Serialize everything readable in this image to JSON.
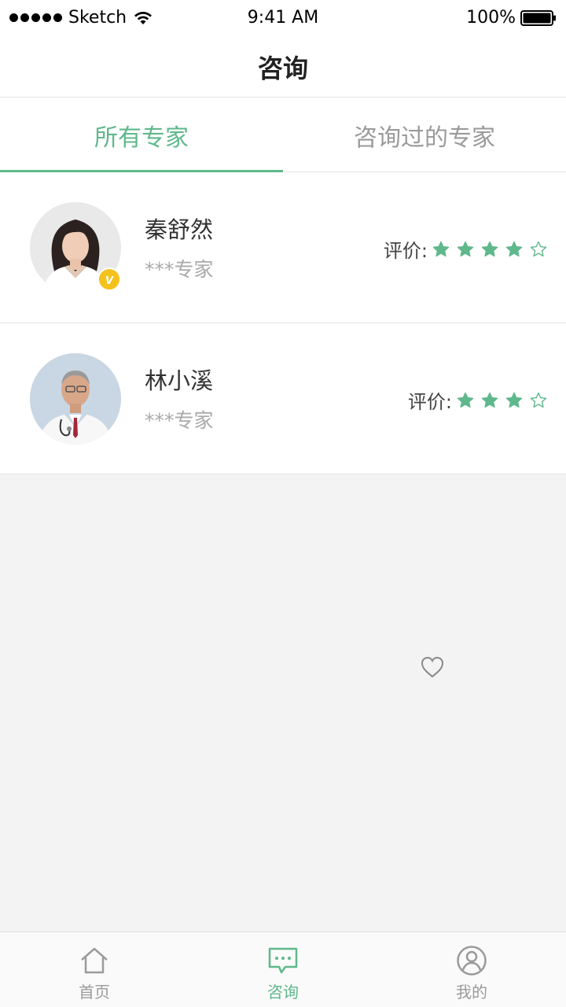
{
  "status_bar": {
    "carrier": "Sketch",
    "time": "9:41 AM",
    "battery": "100%"
  },
  "header": {
    "title": "咨询"
  },
  "tabs": [
    {
      "label": "所有专家",
      "active": true
    },
    {
      "label": "咨询过的专家",
      "active": false
    }
  ],
  "experts": [
    {
      "name": "秦舒然",
      "title": "***专家",
      "rating_label": "评价:",
      "rating": 4,
      "max_rating": 5,
      "vip": true,
      "vip_mark": "v"
    },
    {
      "name": "林小溪",
      "title": "***专家",
      "rating_label": "评价:",
      "rating": 3,
      "max_rating": 4,
      "vip": false
    }
  ],
  "tab_bar": [
    {
      "label": "首页",
      "icon": "home-icon",
      "active": false
    },
    {
      "label": "咨询",
      "icon": "chat-icon",
      "active": true
    },
    {
      "label": "我的",
      "icon": "profile-icon",
      "active": false
    }
  ],
  "colors": {
    "accent": "#5fb88c",
    "vip_badge": "#f4c21c",
    "inactive": "#9a9a9a",
    "background": "#f3f3f3"
  }
}
